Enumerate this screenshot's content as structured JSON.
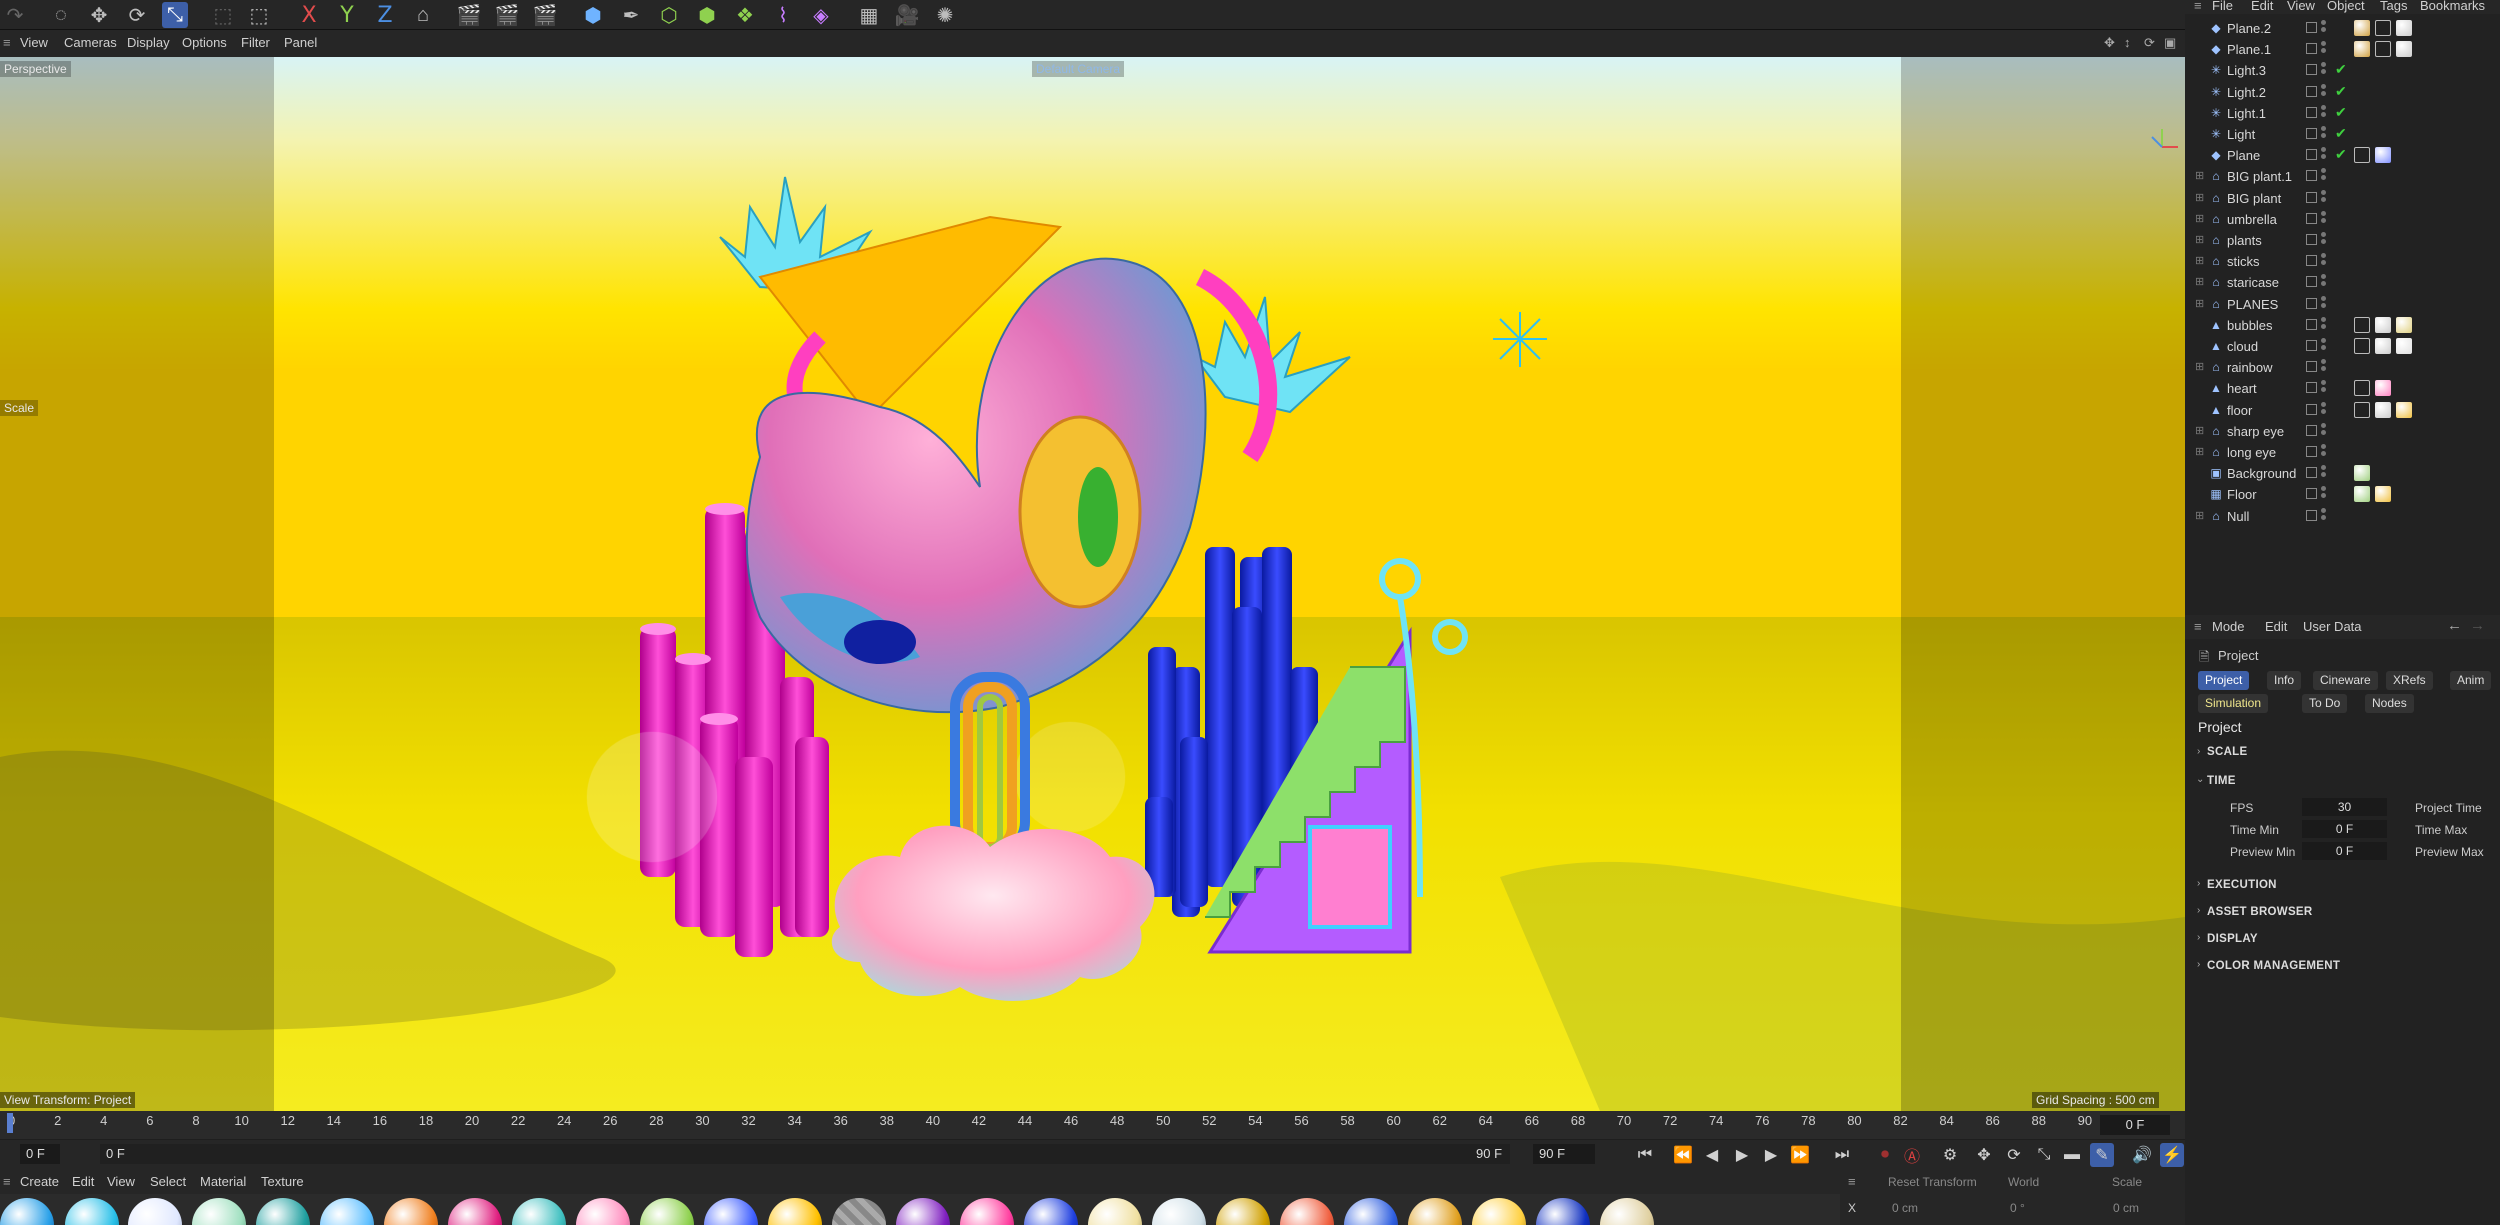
{
  "viewport_menu": [
    "View",
    "Cameras",
    "Display",
    "Options",
    "Filter",
    "Panel"
  ],
  "viewport": {
    "projection_label": "Perspective",
    "camera_label": "Default Camera",
    "scale_label": "Scale",
    "view_transform": "View Transform: Project",
    "grid_spacing": "Grid Spacing : 500 cm"
  },
  "toolbar": {
    "axis_x": "X",
    "axis_y": "Y",
    "axis_z": "Z"
  },
  "timeline": {
    "ticks": [
      "0",
      "2",
      "4",
      "6",
      "8",
      "10",
      "12",
      "14",
      "16",
      "18",
      "20",
      "22",
      "24",
      "26",
      "28",
      "30",
      "32",
      "34",
      "36",
      "38",
      "40",
      "42",
      "44",
      "46",
      "48",
      "50",
      "52",
      "54",
      "56",
      "58",
      "60",
      "62",
      "64",
      "66",
      "68",
      "70",
      "72",
      "74",
      "76",
      "78",
      "80",
      "82",
      "84",
      "86",
      "88",
      "90"
    ],
    "current_frame_right": "0 F",
    "current_frame": "0 F",
    "start_frame": "0 F",
    "end_frame_a": "90 F",
    "end_frame_b": "90 F"
  },
  "material_menu": [
    "Create",
    "Edit",
    "View",
    "Select",
    "Material",
    "Texture"
  ],
  "coords": {
    "reset_label": "Reset Transform",
    "space": "World",
    "mode": "Scale",
    "x_label": "X",
    "x_pos": "0 cm",
    "x_rot": "0 °",
    "x_scale": "0 cm"
  },
  "object_manager": {
    "menu": [
      "File",
      "Edit",
      "View",
      "Object",
      "Tags",
      "Bookmarks"
    ],
    "objects": [
      {
        "name": "Plane.2",
        "icon": "◆",
        "check": false
      },
      {
        "name": "Plane.1",
        "icon": "◆",
        "check": false
      },
      {
        "name": "Light.3",
        "icon": "✳",
        "check": true
      },
      {
        "name": "Light.2",
        "icon": "✳",
        "check": true
      },
      {
        "name": "Light.1",
        "icon": "✳",
        "check": true
      },
      {
        "name": "Light",
        "icon": "✳",
        "check": true
      },
      {
        "name": "Plane",
        "icon": "◆",
        "check": true
      },
      {
        "name": "BIG plant.1",
        "icon": "⌂",
        "check": false
      },
      {
        "name": "BIG plant",
        "icon": "⌂",
        "check": false
      },
      {
        "name": "umbrella",
        "icon": "⌂",
        "check": false
      },
      {
        "name": "plants",
        "icon": "⌂",
        "check": false
      },
      {
        "name": "sticks",
        "icon": "⌂",
        "check": false
      },
      {
        "name": "staricase",
        "icon": "⌂",
        "check": false
      },
      {
        "name": "PLANES",
        "icon": "⌂",
        "check": false
      },
      {
        "name": "bubbles",
        "icon": "▲",
        "check": false
      },
      {
        "name": "cloud",
        "icon": "▲",
        "check": false
      },
      {
        "name": "rainbow",
        "icon": "⌂",
        "check": false
      },
      {
        "name": "heart",
        "icon": "▲",
        "check": false
      },
      {
        "name": "floor",
        "icon": "▲",
        "check": false
      },
      {
        "name": "sharp eye",
        "icon": "⌂",
        "check": false
      },
      {
        "name": "long eye",
        "icon": "⌂",
        "check": false
      },
      {
        "name": "Background",
        "icon": "▣",
        "check": false
      },
      {
        "name": "Floor",
        "icon": "▦",
        "check": false
      },
      {
        "name": "Null",
        "icon": "⌂",
        "check": false
      }
    ]
  },
  "attributes": {
    "menu": [
      "Mode",
      "Edit",
      "User Data"
    ],
    "object_label": "Project",
    "tabs_row1": [
      "Project",
      "Info",
      "Cineware",
      "XRefs",
      "Anim"
    ],
    "tabs_row2": [
      "Simulation",
      "To Do",
      "Nodes"
    ],
    "heading": "Project",
    "sections": [
      "SCALE",
      "TIME",
      "EXECUTION",
      "ASSET BROWSER",
      "DISPLAY",
      "COLOR MANAGEMENT"
    ],
    "params": {
      "fps_label": "FPS",
      "fps_value": "30",
      "time_min_label": "Time Min",
      "time_min_value": "0 F",
      "preview_min_label": "Preview Min",
      "preview_min_value": "0 F",
      "project_time_label": "Project Time",
      "time_max_label": "Time Max",
      "preview_max_label": "Preview Max"
    }
  },
  "colors": {
    "accent": "#3d5fa8",
    "check_green": "#3fd03f",
    "record_red": "#d94040"
  }
}
